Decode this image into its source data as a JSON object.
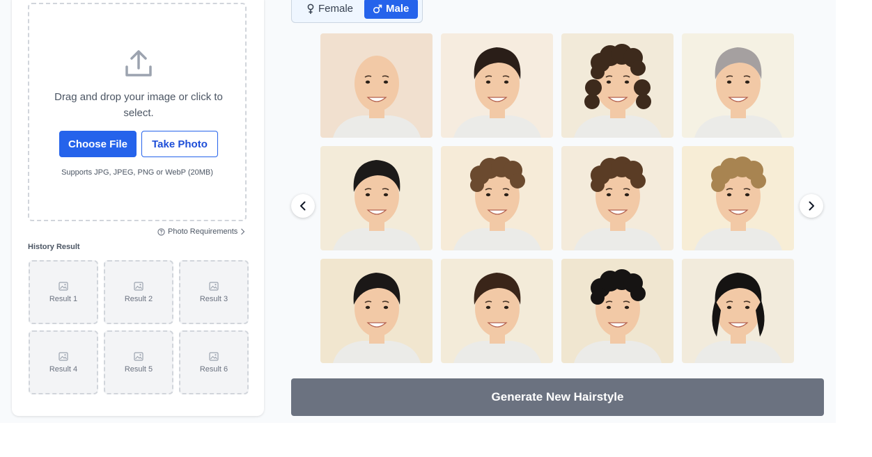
{
  "upload": {
    "drop_text": "Drag and drop your image or click to select.",
    "choose_file": "Choose File",
    "take_photo": "Take Photo",
    "supports": "Supports JPG, JPEG, PNG or WebP (20MB)",
    "photo_requirements": "Photo Requirements"
  },
  "history": {
    "title": "History Result",
    "results": [
      "Result 1",
      "Result 2",
      "Result 3",
      "Result 4",
      "Result 5",
      "Result 6"
    ]
  },
  "gender": {
    "female": "Female",
    "male": "Male",
    "selected": "Male"
  },
  "hairstyles": [
    {
      "name": "bald",
      "hair": "none",
      "bg": "#f1e0cf"
    },
    {
      "name": "short-dark-fringe",
      "hair": "#2a1e18",
      "bg": "#f6ecdf"
    },
    {
      "name": "long-curly-brown",
      "hair": "#3d2a1c",
      "bg": "#f2ead9"
    },
    {
      "name": "silver-textured",
      "hair": "#a5a0a0",
      "bg": "#f5f1e3"
    },
    {
      "name": "black-textured-crop",
      "hair": "#1c1a19",
      "bg": "#f3ebd9"
    },
    {
      "name": "curly-medium-brown",
      "hair": "#6b4a2f",
      "bg": "#f6ebd8"
    },
    {
      "name": "curly-top-brown",
      "hair": "#5a3c25",
      "bg": "#f4ebdb"
    },
    {
      "name": "curly-blonde",
      "hair": "#a88451",
      "bg": "#f7edd6"
    },
    {
      "name": "black-side-part",
      "hair": "#1b1817",
      "bg": "#f1e6cf"
    },
    {
      "name": "brown-bowl-cut",
      "hair": "#3a2519",
      "bg": "#f3ebd9"
    },
    {
      "name": "black-curly-perm",
      "hair": "#161413",
      "bg": "#f0e6d0"
    },
    {
      "name": "black-layered-long",
      "hair": "#151312",
      "bg": "#f2ebdc"
    }
  ],
  "icons": {
    "upload": "upload-icon",
    "question": "question-circle-icon",
    "image": "image-placeholder-icon",
    "prev": "chevron-left-icon",
    "next": "chevron-right-icon"
  },
  "colors": {
    "primary": "#2563eb",
    "generate_disabled": "#6b7280",
    "skin": "#f2c9a6"
  },
  "generate_label": "Generate New Hairstyle"
}
